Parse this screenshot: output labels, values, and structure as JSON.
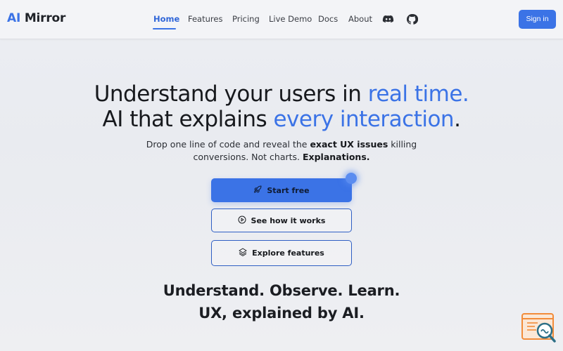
{
  "brand": {
    "part1": "AI",
    "part2": "Mirror"
  },
  "nav": {
    "items": [
      {
        "label": "Home",
        "active": true
      },
      {
        "label": "Features"
      },
      {
        "label": "Pricing"
      },
      {
        "label": "Live Demo"
      },
      {
        "label": "Docs"
      },
      {
        "label": "About"
      }
    ],
    "icons": [
      "discord-icon",
      "github-icon"
    ]
  },
  "signin_label": "Sign in",
  "hero": {
    "line1_pre": "Understand your users in ",
    "line1_accent": "real time.",
    "line2_pre": "AI that explains ",
    "line2_accent": "every interaction",
    "line2_post": ".",
    "sub_pre": "Drop one line of code and reveal the ",
    "sub_bold1": "exact UX issues",
    "sub_mid": " killing",
    "sub_line2": "conversions. Not charts. ",
    "sub_bold2": "Explanations."
  },
  "buttons": {
    "start": "Start free",
    "how": "See how it works",
    "explore": "Explore features"
  },
  "tagline": {
    "line1": "Understand. Observe. Learn.",
    "line2": "UX, explained by AI."
  },
  "colors": {
    "accent": "#3b73e6",
    "widget": "#f28c3a"
  }
}
